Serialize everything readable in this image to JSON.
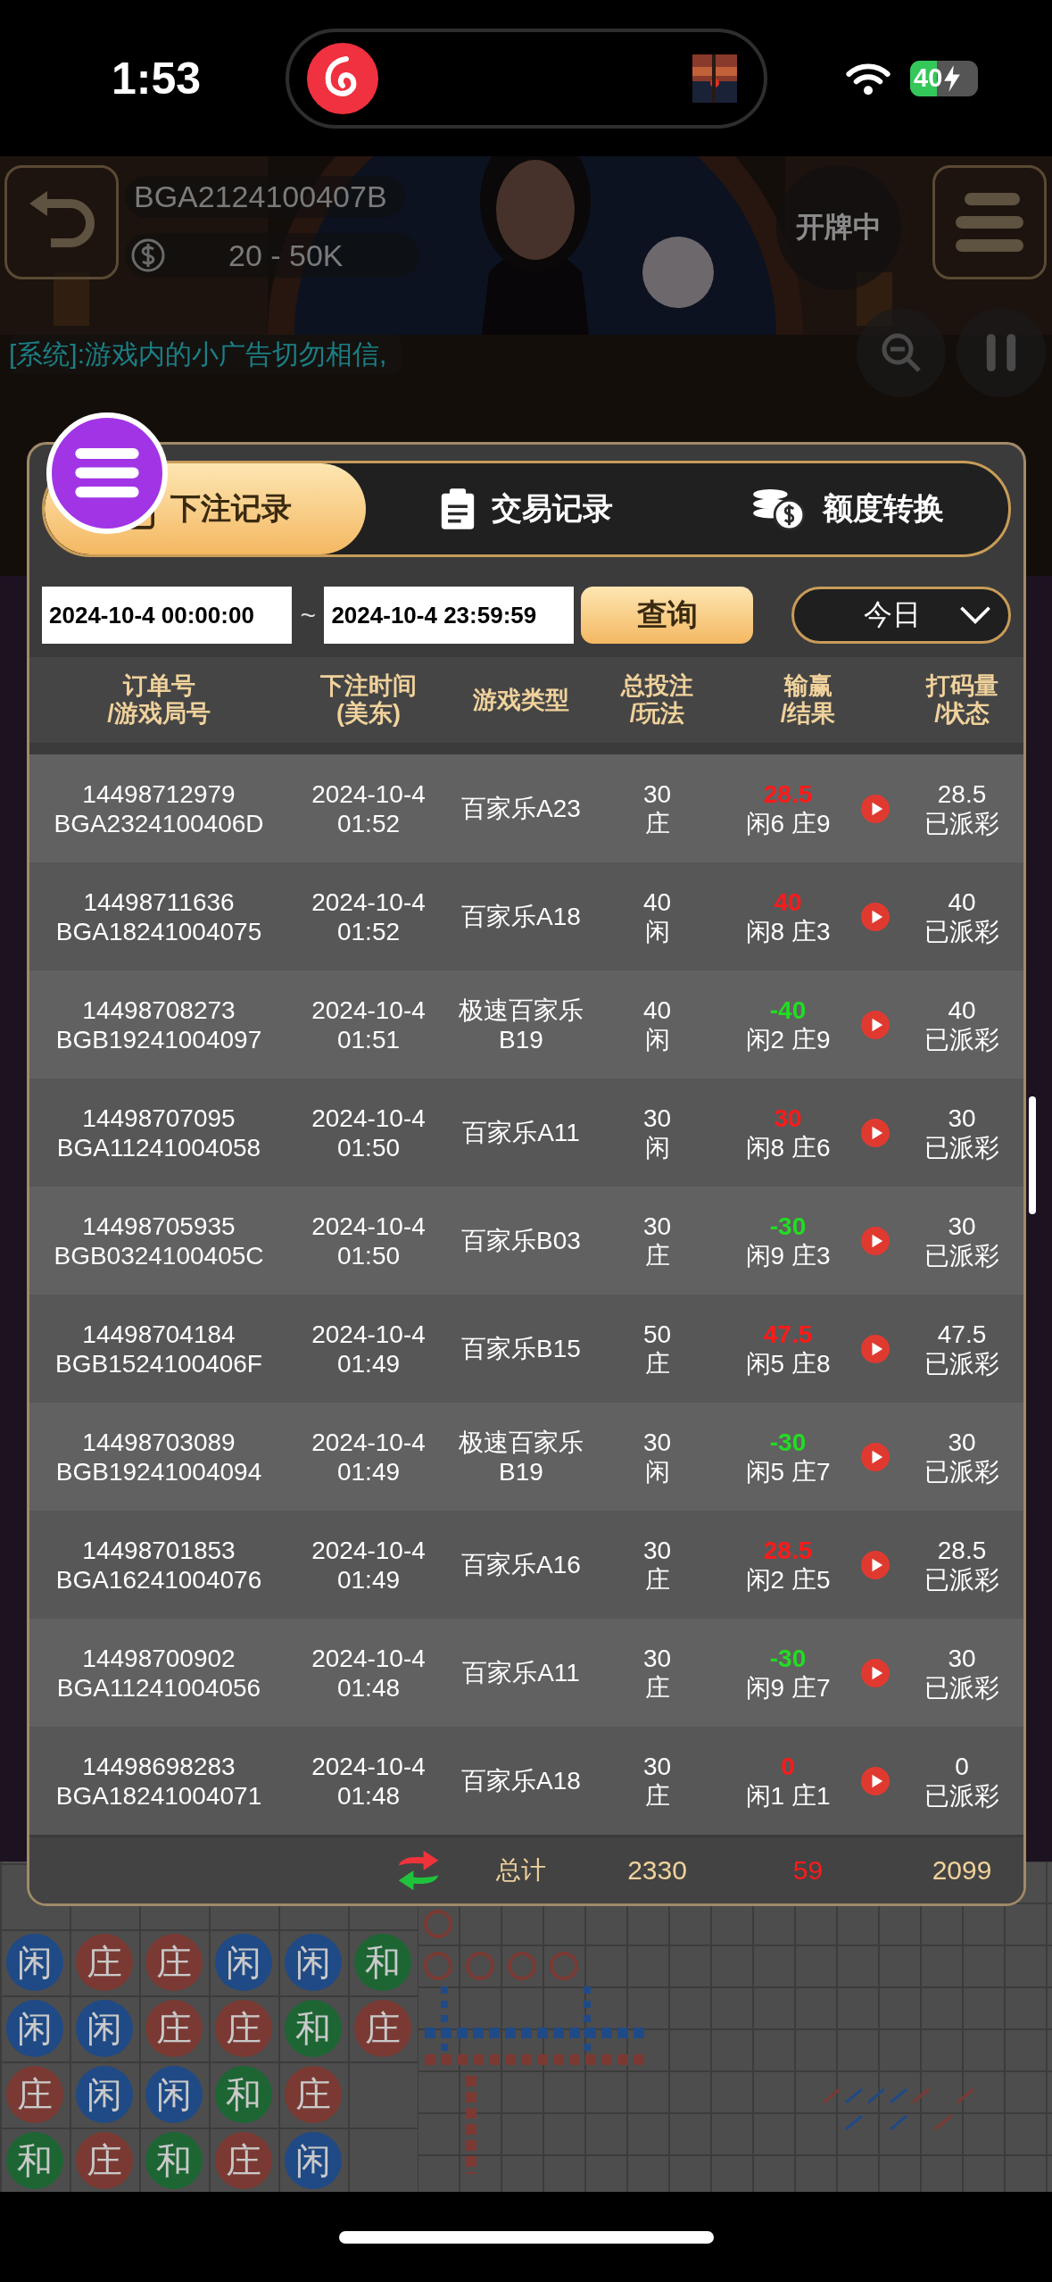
{
  "status_bar": {
    "time": "1:53",
    "battery": "40"
  },
  "game": {
    "table_id": "BGA2124100407B",
    "limits": "20 - 50K",
    "state": "开牌中",
    "chat": "[系统]:游戏内的小广告切勿相信,"
  },
  "record_panel": {
    "tabs": [
      {
        "label": "下注记录",
        "selected": true
      },
      {
        "label": "交易记录",
        "selected": false
      },
      {
        "label": "额度转换",
        "selected": false
      }
    ],
    "filter": {
      "start": "2024-10-4 00:00:00",
      "separator": "~",
      "end": "2024-10-4 23:59:59",
      "query_button": "查询",
      "period": "今日"
    },
    "columns": [
      {
        "label": "订单号",
        "sublabel": "/游戏局号"
      },
      {
        "label": "下注时间",
        "sublabel": "(美东)"
      },
      {
        "label": "游戏类型"
      },
      {
        "label": "总投注",
        "sublabel": "/玩法"
      },
      {
        "label": "输赢",
        "sublabel": "/结果"
      },
      {
        "label": "打码量",
        "sublabel": "/状态"
      }
    ],
    "rows": [
      {
        "order_no": "14498712979",
        "round_no": "BGA2324100406D",
        "date": "2024-10-4",
        "time": "01:52",
        "game": "百家乐A23",
        "bet": "30",
        "bet_type": "庄",
        "win_loss": "28.5",
        "color": "#ff1a1a",
        "result": "闲6 庄9",
        "wagered": "28.5",
        "status": "已派彩"
      },
      {
        "order_no": "14498711636",
        "round_no": "BGA18241004075",
        "date": "2024-10-4",
        "time": "01:52",
        "game": "百家乐A18",
        "bet": "40",
        "bet_type": "闲",
        "win_loss": "40",
        "color": "#ff1a1a",
        "result": "闲8 庄3",
        "wagered": "40",
        "status": "已派彩"
      },
      {
        "order_no": "14498708273",
        "round_no": "BGB19241004097",
        "date": "2024-10-4",
        "time": "01:51",
        "game": "极速百家乐B19",
        "bet": "40",
        "bet_type": "闲",
        "win_loss": "-40",
        "color": "#22dd22",
        "result": "闲2 庄9",
        "wagered": "40",
        "status": "已派彩"
      },
      {
        "order_no": "14498707095",
        "round_no": "BGA11241004058",
        "date": "2024-10-4",
        "time": "01:50",
        "game": "百家乐A11",
        "bet": "30",
        "bet_type": "闲",
        "win_loss": "30",
        "color": "#ff1a1a",
        "result": "闲8 庄6",
        "wagered": "30",
        "status": "已派彩"
      },
      {
        "order_no": "14498705935",
        "round_no": "BGB0324100405C",
        "date": "2024-10-4",
        "time": "01:50",
        "game": "百家乐B03",
        "bet": "30",
        "bet_type": "庄",
        "win_loss": "-30",
        "color": "#22dd22",
        "result": "闲9 庄3",
        "wagered": "30",
        "status": "已派彩"
      },
      {
        "order_no": "14498704184",
        "round_no": "BGB1524100406F",
        "date": "2024-10-4",
        "time": "01:49",
        "game": "百家乐B15",
        "bet": "50",
        "bet_type": "庄",
        "win_loss": "47.5",
        "color": "#ff1a1a",
        "result": "闲5 庄8",
        "wagered": "47.5",
        "status": "已派彩"
      },
      {
        "order_no": "14498703089",
        "round_no": "BGB19241004094",
        "date": "2024-10-4",
        "time": "01:49",
        "game": "极速百家乐B19",
        "bet": "30",
        "bet_type": "闲",
        "win_loss": "-30",
        "color": "#22dd22",
        "result": "闲5 庄7",
        "wagered": "30",
        "status": "已派彩"
      },
      {
        "order_no": "14498701853",
        "round_no": "BGA16241004076",
        "date": "2024-10-4",
        "time": "01:49",
        "game": "百家乐A16",
        "bet": "30",
        "bet_type": "庄",
        "win_loss": "28.5",
        "color": "#ff1a1a",
        "result": "闲2 庄5",
        "wagered": "28.5",
        "status": "已派彩"
      },
      {
        "order_no": "14498700902",
        "round_no": "BGA11241004056",
        "date": "2024-10-4",
        "time": "01:48",
        "game": "百家乐A11",
        "bet": "30",
        "bet_type": "庄",
        "win_loss": "-30",
        "color": "#22dd22",
        "result": "闲9 庄7",
        "wagered": "30",
        "status": "已派彩"
      },
      {
        "order_no": "14498698283",
        "round_no": "BGA18241004071",
        "date": "2024-10-4",
        "time": "01:48",
        "game": "百家乐A18",
        "bet": "30",
        "bet_type": "庄",
        "win_loss": "0",
        "color": "#ff1a1a",
        "result": "闲1 庄1",
        "wagered": "0",
        "status": "已派彩"
      }
    ],
    "totals": {
      "label": "总计",
      "bet": "2330",
      "win_loss": "59",
      "color": "#ff1a1a",
      "wagered": "2099"
    }
  },
  "bead_road": [
    [
      {
        "text": "闲",
        "kind": "player"
      },
      {
        "text": "庄",
        "kind": "banker"
      },
      {
        "text": "庄",
        "kind": "banker"
      },
      {
        "text": "闲",
        "kind": "player"
      },
      {
        "text": "闲",
        "kind": "player"
      },
      {
        "text": "和",
        "kind": "tie"
      }
    ],
    [
      {
        "text": "闲",
        "kind": "player"
      },
      {
        "text": "闲",
        "kind": "player"
      },
      {
        "text": "庄",
        "kind": "banker"
      },
      {
        "text": "庄",
        "kind": "banker"
      },
      {
        "text": "和",
        "kind": "tie"
      },
      {
        "text": "庄",
        "kind": "banker"
      }
    ],
    [
      {
        "text": "庄",
        "kind": "banker"
      },
      {
        "text": "闲",
        "kind": "player"
      },
      {
        "text": "闲",
        "kind": "player"
      },
      {
        "text": "和",
        "kind": "tie"
      },
      {
        "text": "庄",
        "kind": "banker"
      }
    ],
    [
      {
        "text": "和",
        "kind": "tie"
      },
      {
        "text": "庄",
        "kind": "banker"
      },
      {
        "text": "和",
        "kind": "tie"
      },
      {
        "text": "庄",
        "kind": "banker"
      },
      {
        "text": "闲",
        "kind": "player"
      }
    ]
  ]
}
